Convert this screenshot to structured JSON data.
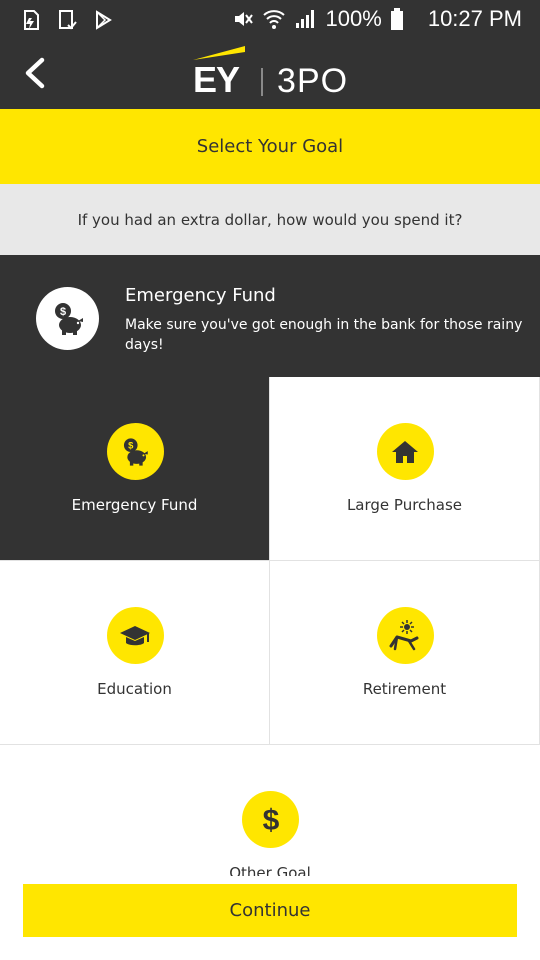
{
  "status_bar": {
    "left_icons": [
      "sd-card-icon",
      "screenshot-icon",
      "play-store-icon"
    ],
    "right_icons": [
      "mute-icon",
      "wifi-icon",
      "signal-icon",
      "battery-icon"
    ],
    "battery": "100%",
    "time": "10:27 PM"
  },
  "header": {
    "back_icon": "chevron-left-icon",
    "logo_ey": "EY",
    "logo_product": "3PO"
  },
  "title": "Select Your Goal",
  "question": "If you had an extra dollar, how would you spend it?",
  "selected_goal": {
    "icon": "piggy-bank-icon",
    "title": "Emergency Fund",
    "description": "Make sure you've got enough in the bank for those rainy days!"
  },
  "goals": [
    {
      "label": "Emergency Fund",
      "icon": "piggy-bank-icon",
      "selected": true
    },
    {
      "label": "Large Purchase",
      "icon": "house-icon",
      "selected": false
    },
    {
      "label": "Education",
      "icon": "graduation-cap-icon",
      "selected": false
    },
    {
      "label": "Retirement",
      "icon": "beach-chair-icon",
      "selected": false
    },
    {
      "label": "Other Goal",
      "icon": "dollar-icon",
      "selected": false
    }
  ],
  "continue_label": "Continue",
  "colors": {
    "brand_yellow": "#ffe600",
    "dark": "#333333",
    "light_gray": "#e8e8e8"
  }
}
